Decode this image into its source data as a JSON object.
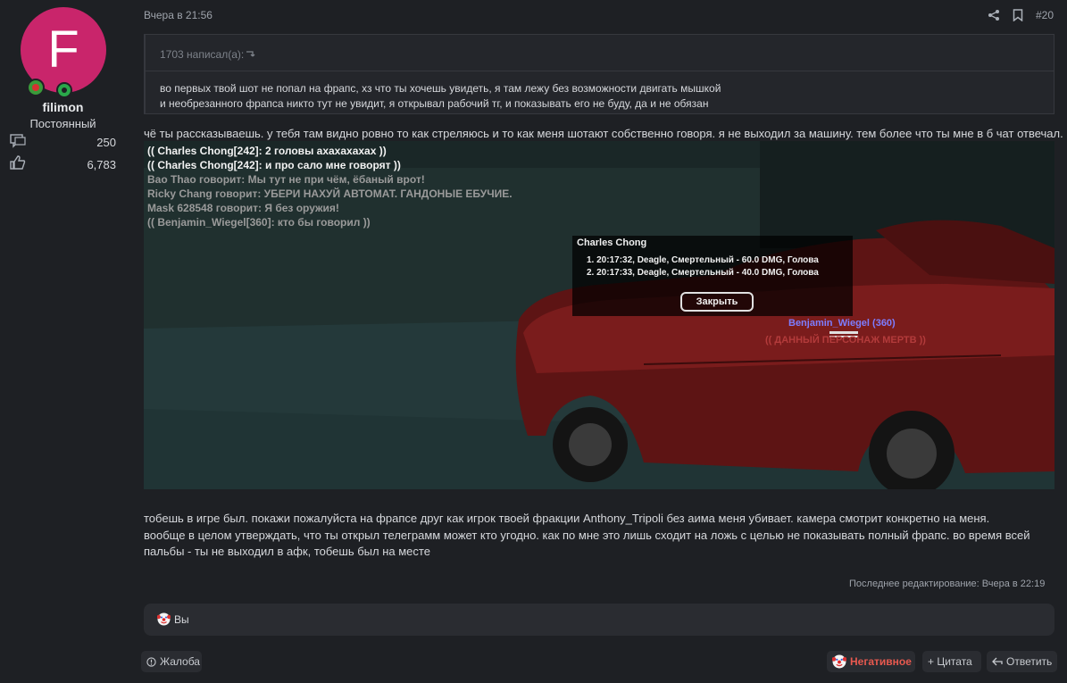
{
  "user": {
    "avatar_letter": "F",
    "name": "filimon",
    "title": "Постоянный",
    "messages_count": "250",
    "reactions_count": "6,783",
    "avatar_color": "#c9256b"
  },
  "post": {
    "date": "Вчера в 21:56",
    "number": "#20",
    "quote": {
      "author": "1703 написал(а):",
      "lines": [
        "во первых твой шот не попал на фрапс, хз что ты хочешь увидеть, я там лежу без возможности двигать мышкой",
        "и необрезанного фрапса никто тут не увидит, я открывал рабочий тг, и показывать его не буду, да и не обязан"
      ]
    },
    "intro": "чё ты рассказываешь. у тебя там видно ровно то как стреляюсь и то как меня шотают собственно говоря. я не выходил за машину. тем более что ты мне в б чат отвечал.",
    "screenshot": {
      "chat": [
        "(( Charles Chong[242]: 2 головы ахахахахах ))",
        "(( Charles Chong[242]: и про сало мне говорят ))",
        "Bao Thao говорит: Мы тут не при чём, ёбаный врот!",
        "Ricky Chang говорит: УБЕРИ НАХУЙ АВТОМАТ. ГАНДОНЫЕ ЕБУЧИЕ.",
        "Mask 628548 говорит: Я без оружия!",
        "(( Benjamin_Wiegel[360]: кто бы говорил ))"
      ],
      "dialog": {
        "title": "Charles Chong",
        "lines": [
          "1. 20:17:32, Deagle, Смертельный - 60.0 DMG, Голова",
          "2. 20:17:33, Deagle, Смертельный - 40.0 DMG, Голова"
        ],
        "close": "Закрыть"
      },
      "nametag": "Benjamin_Wiegel (360)",
      "dead_label": "(( ДАННЫЙ ПЕРСОНАЖ МЕРТВ ))"
    },
    "body": [
      "тобешь в игре был. покажи пожалуйста на фрапсе друг как игрок твоей фракции Anthony_Tripoli без аима меня убивает. камера смотрит конкретно на меня.",
      "вообще в целом утверждать, что ты открыл телеграмм может кто угодно. как по мне это лишь сходит на ложь с целью не показывать полный фрапс. во время всей",
      "пальбы - ты не выходил в афк, тобешь был на месте"
    ],
    "last_edit": "Последнее редактирование: Вчера в 22:19",
    "reactions": {
      "text": "Вы"
    }
  },
  "actions": {
    "report": "Жалоба",
    "negative": "Негативное",
    "quote": "+ Цитата",
    "reply": "Ответить"
  }
}
